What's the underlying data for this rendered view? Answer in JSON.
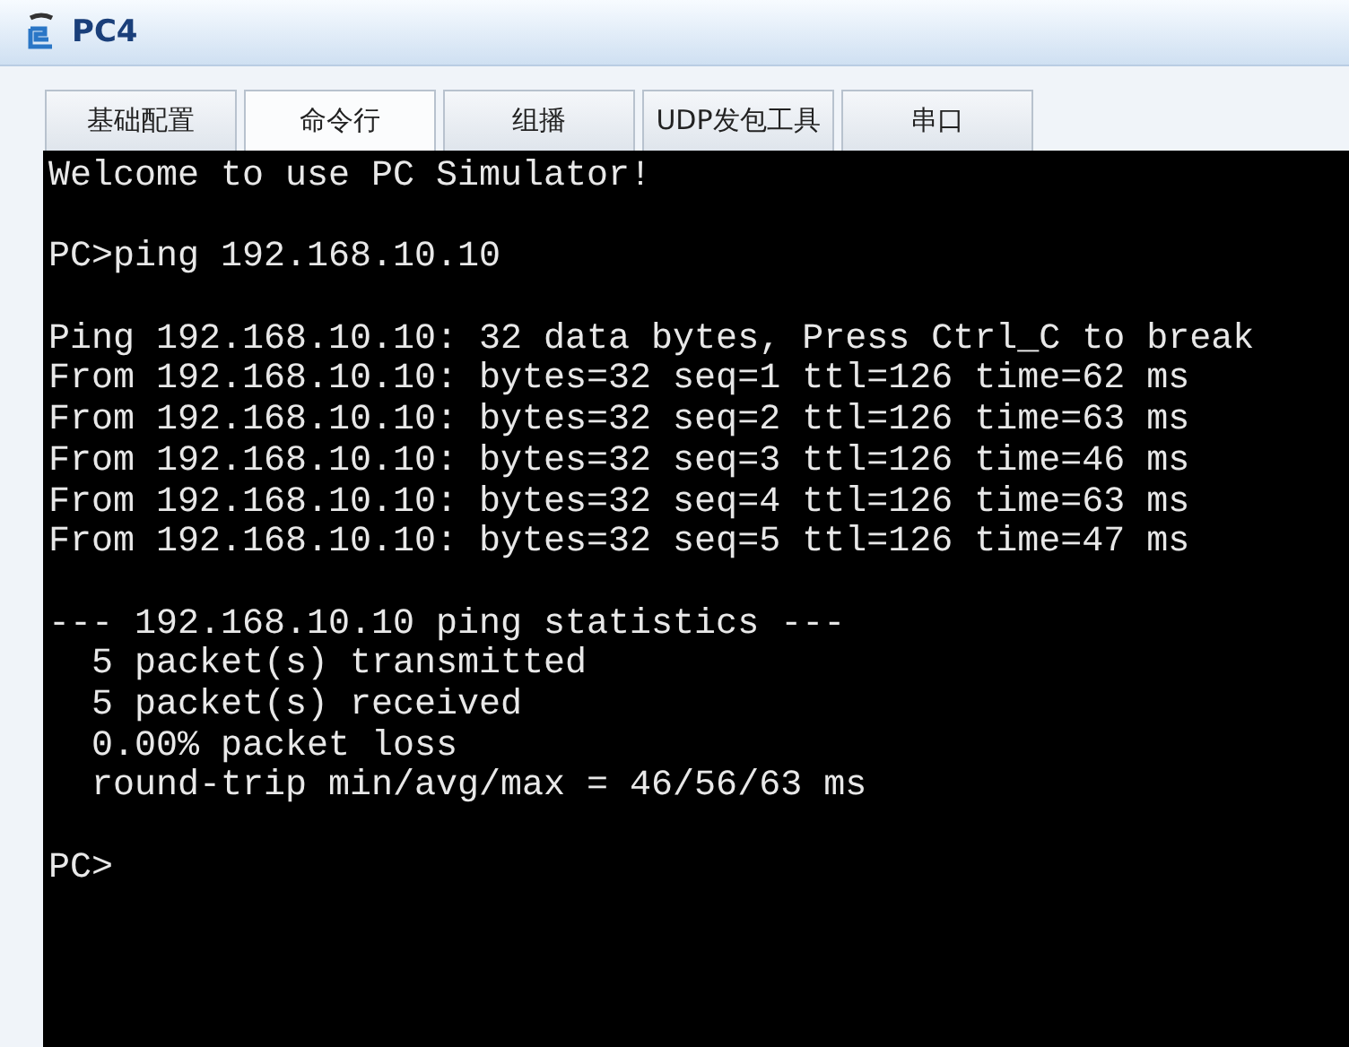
{
  "window": {
    "title": "PC4"
  },
  "tabs": [
    {
      "label": "基础配置",
      "selected": false
    },
    {
      "label": "命令行",
      "selected": true
    },
    {
      "label": "组播",
      "selected": false
    },
    {
      "label": "UDP发包工具",
      "selected": false
    },
    {
      "label": "串口",
      "selected": false
    }
  ],
  "terminal": {
    "blocks": [
      [
        "Welcome to use PC Simulator!"
      ],
      [
        "PC>ping 192.168.10.10"
      ],
      [
        "Ping 192.168.10.10: 32 data bytes, Press Ctrl_C to break",
        "From 192.168.10.10: bytes=32 seq=1 ttl=126 time=62 ms",
        "From 192.168.10.10: bytes=32 seq=2 ttl=126 time=63 ms",
        "From 192.168.10.10: bytes=32 seq=3 ttl=126 time=46 ms",
        "From 192.168.10.10: bytes=32 seq=4 ttl=126 time=63 ms",
        "From 192.168.10.10: bytes=32 seq=5 ttl=126 time=47 ms"
      ],
      [
        "--- 192.168.10.10 ping statistics ---",
        "  5 packet(s) transmitted",
        "  5 packet(s) received",
        "  0.00% packet loss",
        "  round-trip min/avg/max = 46/56/63 ms"
      ],
      [
        "PC>"
      ]
    ]
  }
}
